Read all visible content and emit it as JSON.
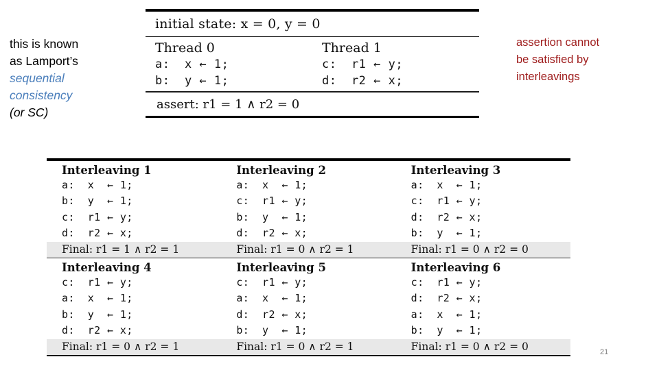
{
  "left_note": {
    "lines": [
      {
        "text": "this is known",
        "style": "plain"
      },
      {
        "text": "as Lamport’s",
        "style": "plain"
      },
      {
        "text": "sequential",
        "style": "blue"
      },
      {
        "text": "consistency",
        "style": "blue"
      },
      {
        "text": "(or SC)",
        "style": "black-italic"
      }
    ],
    "accent_color": "#4a7ebb"
  },
  "right_note": {
    "lines": [
      "assertion cannot",
      "be satisfied by",
      "interleavings"
    ],
    "color": "#9e1b1b"
  },
  "program": {
    "initial_state": "initial state: x = 0, y = 0",
    "threads": [
      {
        "header": "Thread 0",
        "statements": [
          "a:  x ← 1;",
          "b:  y ← 1;"
        ]
      },
      {
        "header": "Thread 1",
        "statements": [
          "c:  r1 ← y;",
          "d:  r2 ← x;"
        ]
      }
    ],
    "assertion": "assert: r1 = 1 ∧ r2 = 0"
  },
  "interleavings": [
    {
      "title": "Interleaving 1",
      "steps": [
        "a:  x  ← 1;",
        "b:  y  ← 1;",
        "c:  r1 ← y;",
        "d:  r2 ← x;"
      ],
      "final": "Final: r1 = 1 ∧ r2 = 1"
    },
    {
      "title": "Interleaving 2",
      "steps": [
        "a:  x  ← 1;",
        "c:  r1 ← y;",
        "b:  y  ← 1;",
        "d:  r2 ← x;"
      ],
      "final": "Final: r1 = 0 ∧ r2 = 1"
    },
    {
      "title": "Interleaving 3",
      "steps": [
        "a:  x  ← 1;",
        "c:  r1 ← y;",
        "d:  r2 ← x;",
        "b:  y  ← 1;"
      ],
      "final": "Final: r1 = 0 ∧ r2 = 0"
    },
    {
      "title": "Interleaving 4",
      "steps": [
        "c:  r1 ← y;",
        "a:  x  ← 1;",
        "b:  y  ← 1;",
        "d:  r2 ← x;"
      ],
      "final": "Final: r1 = 0 ∧ r2 = 1"
    },
    {
      "title": "Interleaving 5",
      "steps": [
        "c:  r1 ← y;",
        "a:  x  ← 1;",
        "d:  r2 ← x;",
        "b:  y  ← 1;"
      ],
      "final": "Final: r1 = 0 ∧ r2 = 1"
    },
    {
      "title": "Interleaving 6",
      "steps": [
        "c:  r1 ← y;",
        "d:  r2 ← x;",
        "a:  x  ← 1;",
        "b:  y  ← 1;"
      ],
      "final": "Final: r1 = 0 ∧ r2 = 0"
    }
  ],
  "page_number": "21"
}
